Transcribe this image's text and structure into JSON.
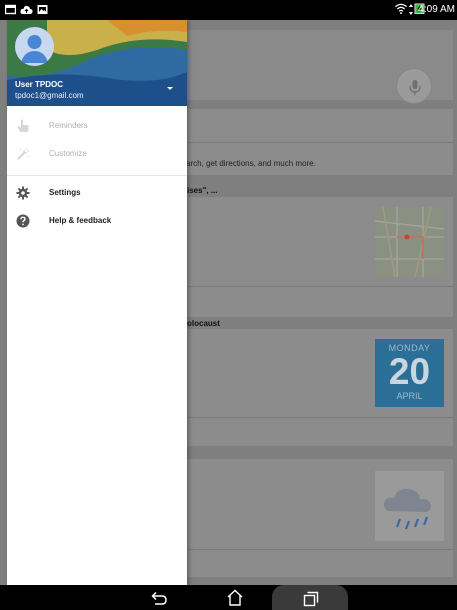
{
  "status_bar": {
    "left_icons": [
      "mail-icon",
      "cloud-upload-icon",
      "image-icon"
    ],
    "right_icons": [
      "wifi-icon",
      "battery-charging-icon"
    ],
    "time": "4:09 AM"
  },
  "drawer": {
    "user_name": "User TPDOC",
    "user_email": "tpdoc1@gmail.com",
    "items": [
      {
        "label": "Reminders",
        "icon": "pointing-hand-icon",
        "enabled": false
      },
      {
        "label": "Customize",
        "icon": "magic-wand-icon",
        "enabled": false
      },
      {
        "label": "Settings",
        "icon": "gear-icon",
        "enabled": true
      },
      {
        "label": "Help & feedback",
        "icon": "help-circle-icon",
        "enabled": true
      }
    ]
  },
  "background": {
    "search_hint": "arch, get directions, and much more.",
    "header_1": "ises\", ...",
    "header_2": "olocaust",
    "calendar": {
      "day": "MONDAY",
      "date": "20",
      "month": "APRIL"
    }
  },
  "nav_bar": {
    "icons": [
      "back-icon",
      "home-icon",
      "recents-icon"
    ]
  }
}
